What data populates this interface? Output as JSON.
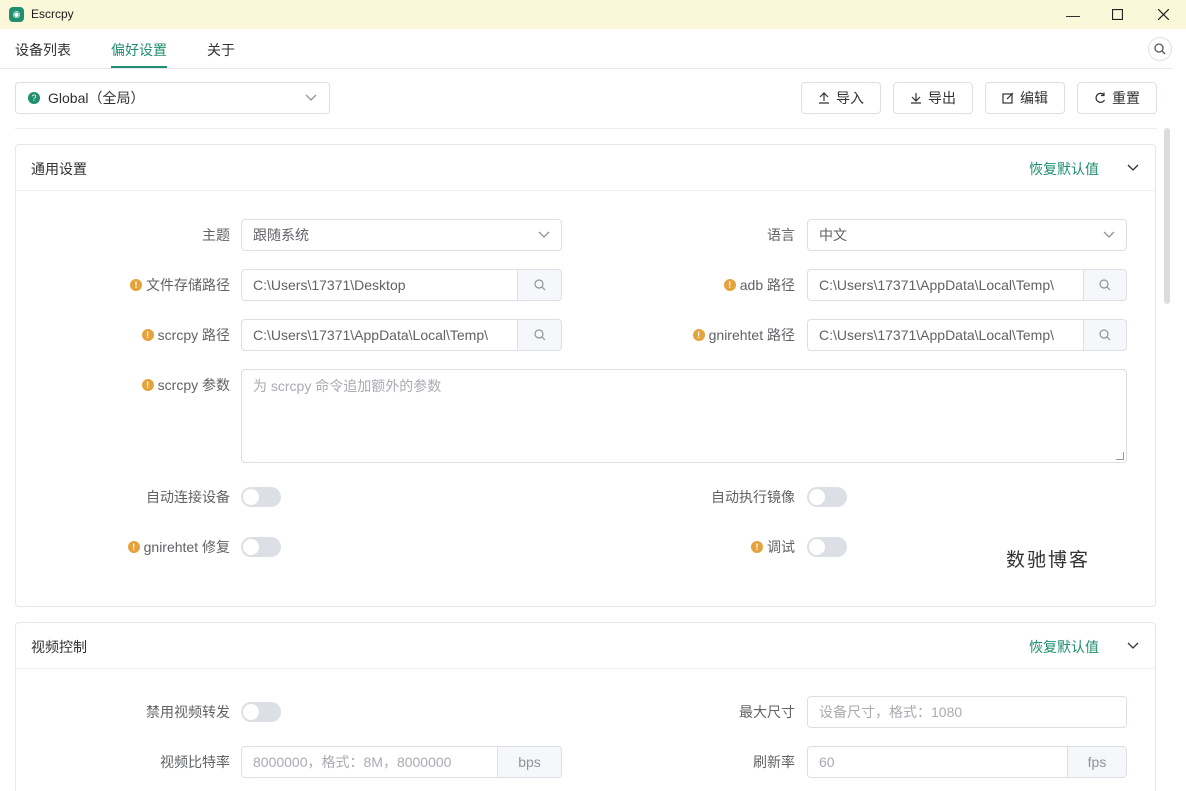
{
  "window": {
    "title": "Escrcpy",
    "app_icon": "escrcpy-logo-icon"
  },
  "tabs": [
    {
      "label": "设备列表"
    },
    {
      "label": "偏好设置"
    },
    {
      "label": "关于"
    }
  ],
  "toolbar": {
    "scope": "Global（全局）",
    "import_label": "导入",
    "export_label": "导出",
    "edit_label": "编辑",
    "reset_label": "重置"
  },
  "general": {
    "title": "通用设置",
    "reset_default": "恢复默认值",
    "theme_label": "主题",
    "theme_value": "跟随系统",
    "language_label": "语言",
    "language_value": "中文",
    "save_path_label": "文件存储路径",
    "save_path_value": "C:\\Users\\17371\\Desktop",
    "adb_path_label": "adb 路径",
    "adb_path_value": "C:\\Users\\17371\\AppData\\Local\\Temp\\",
    "scrcpy_path_label": "scrcpy 路径",
    "scrcpy_path_value": "C:\\Users\\17371\\AppData\\Local\\Temp\\",
    "gnirehtet_path_label": "gnirehtet 路径",
    "gnirehtet_path_value": "C:\\Users\\17371\\AppData\\Local\\Temp\\",
    "scrcpy_args_label": "scrcpy 参数",
    "scrcpy_args_placeholder": "为 scrcpy 命令追加额外的参数",
    "auto_connect_label": "自动连接设备",
    "auto_mirror_label": "自动执行镜像",
    "gnirehtet_fix_label": "gnirehtet 修复",
    "debug_label": "调试"
  },
  "video": {
    "title": "视频控制",
    "reset_default": "恢复默认值",
    "disable_video_label": "禁用视频转发",
    "max_size_label": "最大尺寸",
    "max_size_placeholder": "设备尺寸，格式：1080",
    "bitrate_label": "视频比特率",
    "bitrate_placeholder": "8000000，格式：8M，8000000",
    "bitrate_unit": "bps",
    "fps_label": "刷新率",
    "fps_placeholder": "60",
    "fps_unit": "fps"
  },
  "watermark": "数驰博客",
  "colors": {
    "accent": "#1f8f6e",
    "titlebar": "#fbf8d9",
    "warning": "#e6a23c"
  }
}
